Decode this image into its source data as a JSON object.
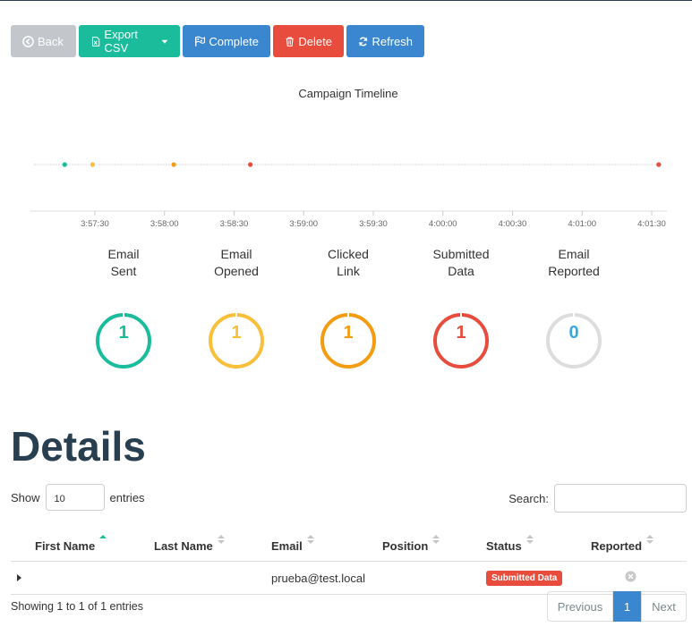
{
  "toolbar": {
    "back_label": "Back",
    "export_label": "Export CSV",
    "complete_label": "Complete",
    "delete_label": "Delete",
    "refresh_label": "Refresh"
  },
  "colors": {
    "sent": "#1abc9c",
    "opened": "#f9bf3b",
    "clicked": "#f39c12",
    "submitted": "#e74c3c",
    "reported": "#dddddd"
  },
  "chart_data": {
    "type": "scatter",
    "title": "Campaign Timeline",
    "x_ticks": [
      "3:57:30",
      "3:58:00",
      "3:58:30",
      "3:59:00",
      "3:59:30",
      "4:00:00",
      "4:00:30",
      "4:01:00",
      "4:01:30"
    ],
    "events": [
      {
        "time": "3:57:17",
        "event": "Email Sent",
        "color": "#1abc9c"
      },
      {
        "time": "3:57:29",
        "event": "Email Opened",
        "color": "#f9bf3b"
      },
      {
        "time": "3:58:04",
        "event": "Clicked Link",
        "color": "#f39c12"
      },
      {
        "time": "3:58:37",
        "event": "Submitted Data",
        "color": "#e74c3c"
      },
      {
        "time": "4:01:33",
        "event": "Submitted Data",
        "color": "#e74c3c"
      }
    ]
  },
  "stats": [
    {
      "label": "Email\nSent",
      "value": "1",
      "color": "#1abc9c"
    },
    {
      "label": "Email\nOpened",
      "value": "1",
      "color": "#f9bf3b"
    },
    {
      "label": "Clicked\nLink",
      "value": "1",
      "color": "#f39c12"
    },
    {
      "label": "Submitted\nData",
      "value": "1",
      "color": "#e74c3c"
    },
    {
      "label": "Email\nReported",
      "value": "0",
      "color": "#dddddd",
      "text_color": "#3aa8e0"
    }
  ],
  "details": {
    "title": "Details",
    "show_label": "Show",
    "entries_value": "10",
    "entries_label": "entries",
    "search_label": "Search:",
    "search_value": "",
    "columns": [
      "First Name",
      "Last Name",
      "Email",
      "Position",
      "Status",
      "Reported"
    ],
    "rows": [
      {
        "first_name": "",
        "last_name": "",
        "email": "prueba@test.local",
        "position": "",
        "status": "Submitted Data",
        "reported": false
      }
    ],
    "showing": "Showing 1 to 1 of 1 entries",
    "pagination": {
      "previous": "Previous",
      "page": "1",
      "next": "Next"
    }
  }
}
